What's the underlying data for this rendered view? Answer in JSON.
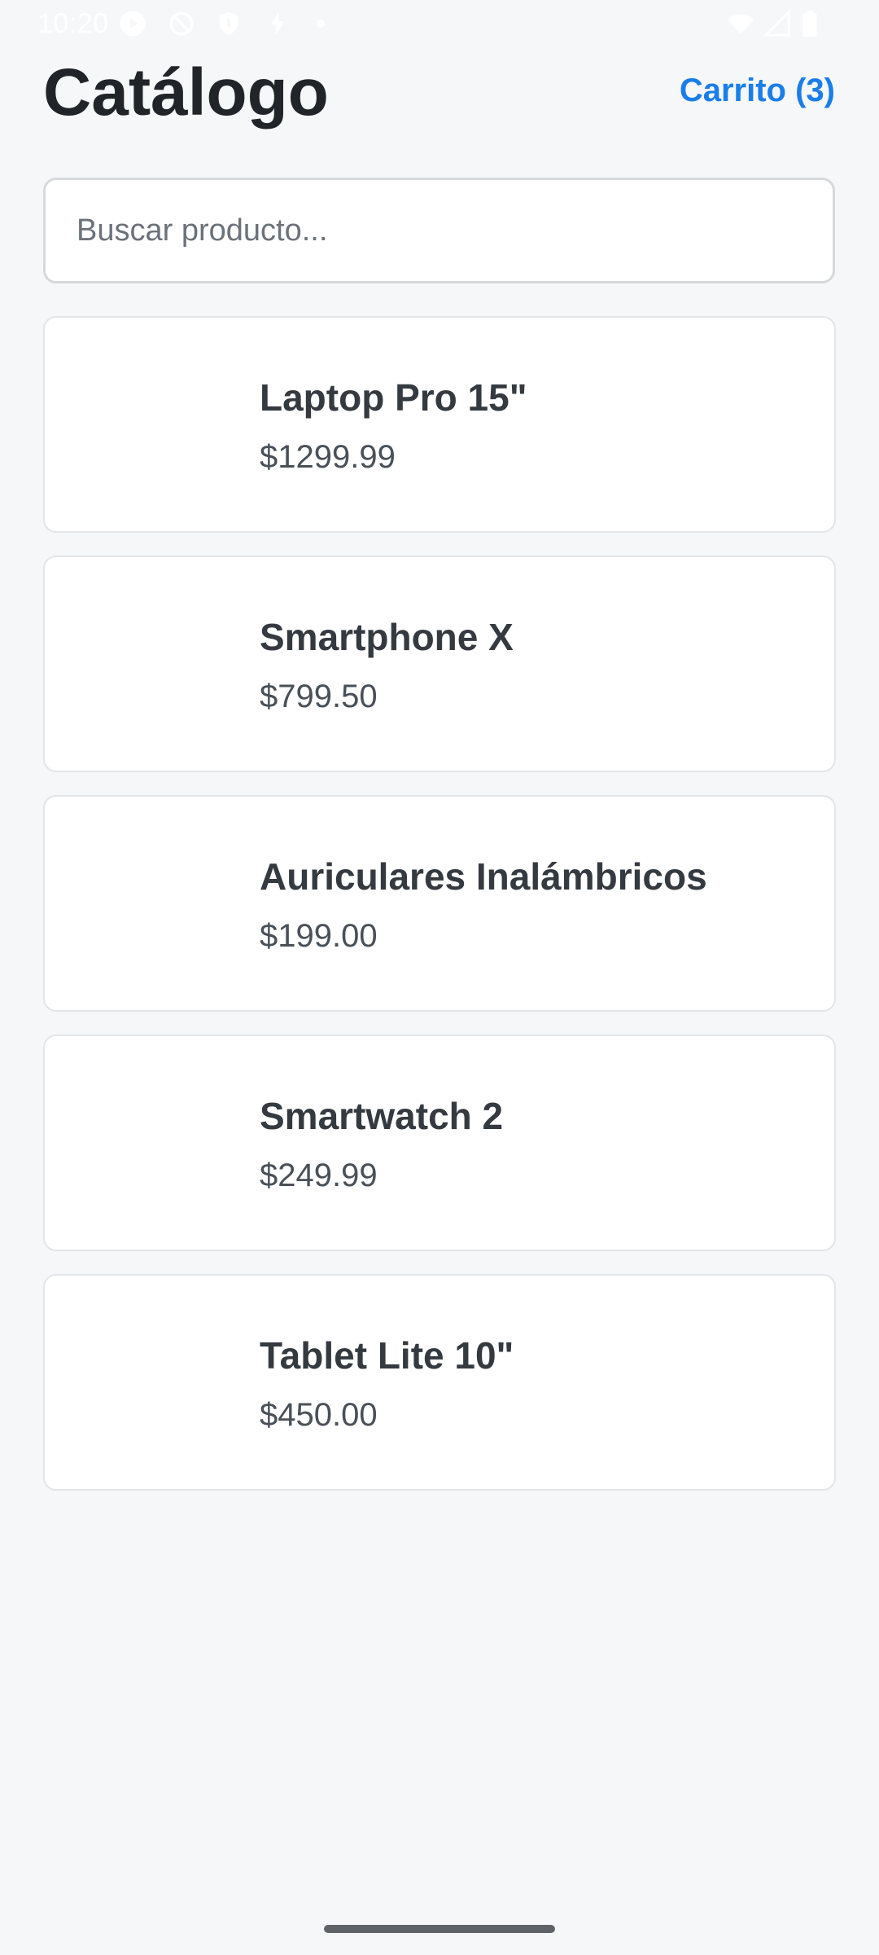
{
  "status_bar": {
    "time": "10:20"
  },
  "header": {
    "title": "Catálogo",
    "cart_label": "Carrito (3)"
  },
  "search": {
    "value": "",
    "placeholder": "Buscar producto..."
  },
  "products": [
    {
      "name": "Laptop Pro 15\"",
      "price": "$1299.99"
    },
    {
      "name": "Smartphone X",
      "price": "$799.50"
    },
    {
      "name": "Auriculares Inalámbricos",
      "price": "$199.00"
    },
    {
      "name": "Smartwatch 2",
      "price": "$249.99"
    },
    {
      "name": "Tablet Lite 10\"",
      "price": "$450.00"
    }
  ],
  "colors": {
    "background": "#f6f7f9",
    "accent": "#1a7ee8",
    "card_border": "#e3e5e8",
    "title": "#212529"
  },
  "icons": {
    "status_left": [
      "play-icon",
      "do-not-disturb-icon",
      "shield-icon",
      "charging-icon",
      "dot-icon"
    ],
    "status_right": [
      "wifi-icon",
      "signal-icon",
      "battery-icon"
    ]
  }
}
